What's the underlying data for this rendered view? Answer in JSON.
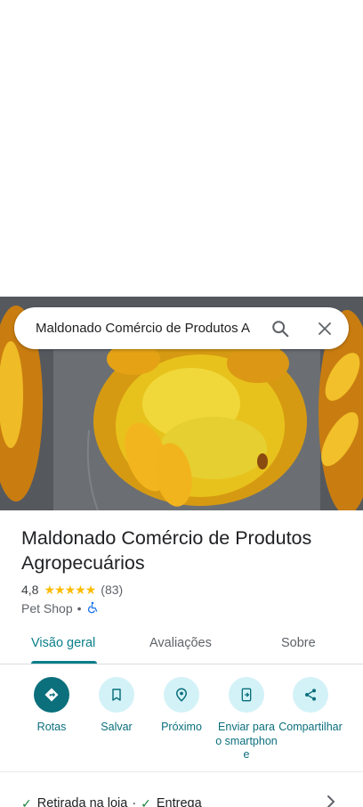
{
  "search": {
    "query": "Maldonado Comércio de Produtos A"
  },
  "place": {
    "name": "Maldonado Comércio de Produtos Agropecuários",
    "rating": "4,8",
    "stars": [
      "★",
      "★",
      "★",
      "★",
      "★"
    ],
    "review_count": "(83)",
    "category": "Pet Shop",
    "separator": "•"
  },
  "tabs": [
    {
      "label": "Visão geral",
      "active": true
    },
    {
      "label": "Avaliações",
      "active": false
    },
    {
      "label": "Sobre",
      "active": false
    }
  ],
  "actions": [
    {
      "label": "Rotas",
      "icon": "directions-icon"
    },
    {
      "label": "Salvar",
      "icon": "bookmark-icon"
    },
    {
      "label": "Próximo",
      "icon": "nearby-icon"
    },
    {
      "label": "Enviar para o smartphone",
      "icon": "send-to-phone-icon"
    },
    {
      "label": "Compartilhar",
      "icon": "share-icon"
    }
  ],
  "services": [
    {
      "label": "Retirada na loja",
      "separator": "·"
    },
    {
      "label": "Entrega"
    }
  ],
  "colors": {
    "accent": "#0b7e8a",
    "action_bg": "#d3f2f8",
    "primary_action_bg": "#0b6f7c",
    "star": "#fbbc04",
    "check": "#188038"
  }
}
